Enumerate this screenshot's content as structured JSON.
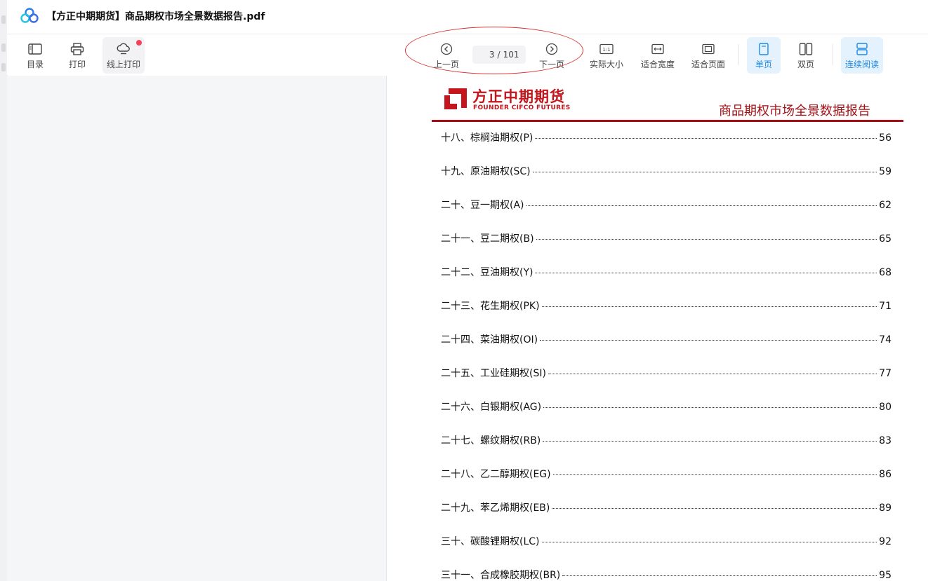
{
  "document": {
    "title": "【方正中期期货】商品期权市场全景数据报告.pdf"
  },
  "toolbar": {
    "toc_label": "目录",
    "print_label": "打印",
    "online_print_label": "线上打印",
    "prev_label": "上一页",
    "next_label": "下一页",
    "current_page": "3",
    "page_separator": "/",
    "total_pages": "101",
    "actual_size_label": "实际大小",
    "fit_width_label": "适合宽度",
    "fit_page_label": "适合页面",
    "single_page_label": "单页",
    "double_page_label": "双页",
    "continuous_label": "连续阅读",
    "actual_size_icon_text": "1:1"
  },
  "page": {
    "logo_cn": "方正中期期货",
    "logo_en": "FOUNDER CIFCO FUTURES",
    "report_title": "商品期权市场全景数据报告",
    "toc": [
      {
        "title": "十八、棕榈油期权(P)",
        "page": "56"
      },
      {
        "title": "十九、原油期权(SC)",
        "page": "59"
      },
      {
        "title": "二十、豆一期权(A)",
        "page": "62"
      },
      {
        "title": "二十一、豆二期权(B)",
        "page": "65"
      },
      {
        "title": "二十二、豆油期权(Y)",
        "page": "68"
      },
      {
        "title": "二十三、花生期权(PK)",
        "page": "71"
      },
      {
        "title": "二十四、菜油期权(OI)",
        "page": "74"
      },
      {
        "title": "二十五、工业硅期权(SI)",
        "page": "77"
      },
      {
        "title": "二十六、白银期权(AG)",
        "page": "80"
      },
      {
        "title": "二十七、螺纹期权(RB)",
        "page": "83"
      },
      {
        "title": "二十八、乙二醇期权(EG)",
        "page": "86"
      },
      {
        "title": "二十九、苯乙烯期权(EB)",
        "page": "89"
      },
      {
        "title": "三十、碳酸锂期权(LC)",
        "page": "92"
      },
      {
        "title": "三十一、合成橡胶期权(BR)",
        "page": "95"
      }
    ]
  },
  "colors": {
    "brand_red": "#c4161c",
    "report_red": "#a30f14",
    "active_blue": "#1e88e5",
    "active_bg": "#e3f2fd",
    "annotation_red": "#d93030",
    "notify_dot": "#f2435a"
  }
}
